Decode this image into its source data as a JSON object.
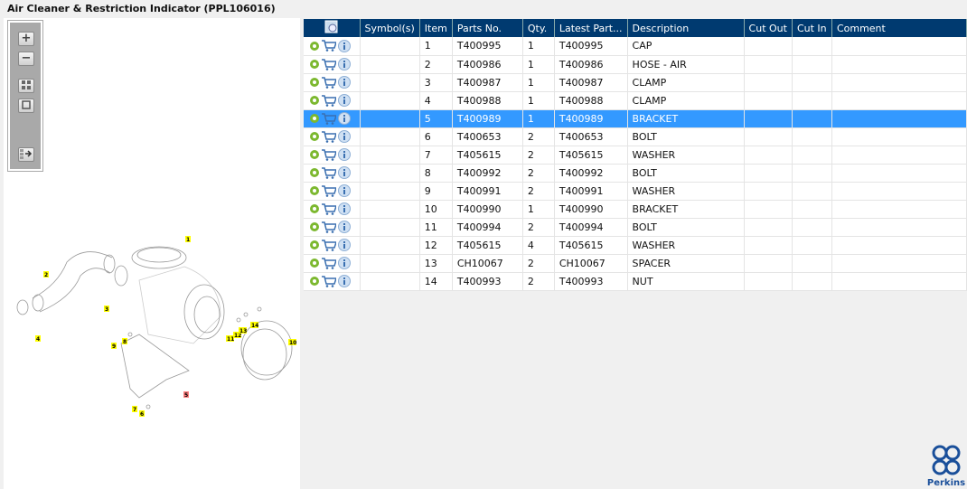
{
  "title": "Air Cleaner & Restriction Indicator (PPL106016)",
  "toolbar": {
    "zoom_in": "+",
    "zoom_out": "−"
  },
  "columns": [
    "Symbol(s)",
    "Item",
    "Parts No.",
    "Qty.",
    "Latest Part...",
    "Description",
    "Cut Out",
    "Cut In",
    "Comment"
  ],
  "rows": [
    {
      "item": "1",
      "part": "T400995",
      "qty": "1",
      "latest": "T400995",
      "desc": "CAP"
    },
    {
      "item": "2",
      "part": "T400986",
      "qty": "1",
      "latest": "T400986",
      "desc": "HOSE - AIR"
    },
    {
      "item": "3",
      "part": "T400987",
      "qty": "1",
      "latest": "T400987",
      "desc": "CLAMP"
    },
    {
      "item": "4",
      "part": "T400988",
      "qty": "1",
      "latest": "T400988",
      "desc": "CLAMP"
    },
    {
      "item": "5",
      "part": "T400989",
      "qty": "1",
      "latest": "T400989",
      "desc": "BRACKET"
    },
    {
      "item": "6",
      "part": "T400653",
      "qty": "2",
      "latest": "T400653",
      "desc": "BOLT"
    },
    {
      "item": "7",
      "part": "T405615",
      "qty": "2",
      "latest": "T405615",
      "desc": "WASHER"
    },
    {
      "item": "8",
      "part": "T400992",
      "qty": "2",
      "latest": "T400992",
      "desc": "BOLT"
    },
    {
      "item": "9",
      "part": "T400991",
      "qty": "2",
      "latest": "T400991",
      "desc": "WASHER"
    },
    {
      "item": "10",
      "part": "T400990",
      "qty": "1",
      "latest": "T400990",
      "desc": "BRACKET"
    },
    {
      "item": "11",
      "part": "T400994",
      "qty": "2",
      "latest": "T400994",
      "desc": "BOLT"
    },
    {
      "item": "12",
      "part": "T405615",
      "qty": "4",
      "latest": "T405615",
      "desc": "WASHER"
    },
    {
      "item": "13",
      "part": "CH10067",
      "qty": "2",
      "latest": "CH10067",
      "desc": "SPACER"
    },
    {
      "item": "14",
      "part": "T400993",
      "qty": "2",
      "latest": "T400993",
      "desc": "NUT"
    }
  ],
  "selected_item": "5",
  "callouts": [
    "1",
    "2",
    "3",
    "4",
    "5",
    "6",
    "7",
    "8",
    "9",
    "10",
    "11",
    "12",
    "13",
    "14"
  ],
  "logo": "Perkins",
  "colors": {
    "header": "#003a70",
    "selected": "#3399ff",
    "callout": "#ffff00",
    "callout_selected": "#ff8080"
  }
}
